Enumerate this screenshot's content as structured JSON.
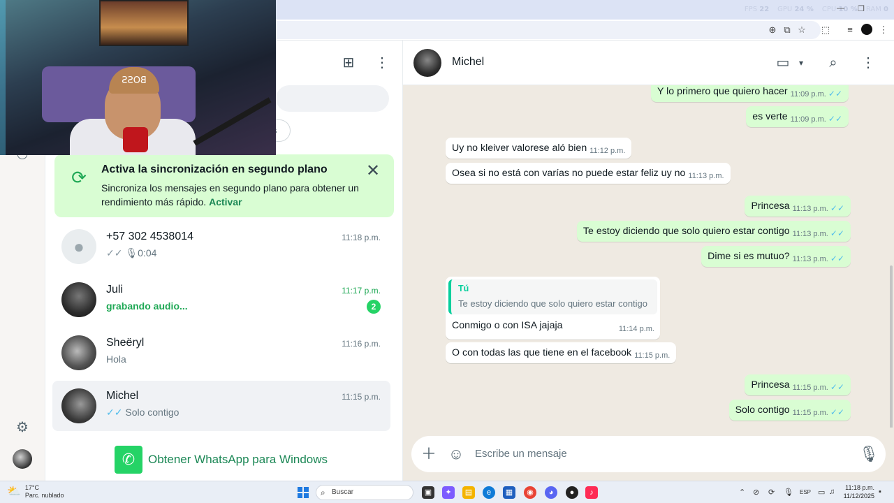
{
  "browser": {
    "stats": {
      "fps_label": "FPS",
      "fps": "22",
      "gpu_label": "GPU",
      "gpu": "24 %",
      "cpu_label": "CPU",
      "cpu": "10 %",
      "ram_label": "RAM",
      "ram": "0"
    }
  },
  "webcam": {
    "cap_text": "BOSS"
  },
  "chat_list": {
    "sync_banner": {
      "title": "Activa la sincronización en segundo plano",
      "body": "Sincroniza los mensajes en segundo plano para obtener un rendimiento más rápido.",
      "link": "Activar"
    },
    "filter_chip_fragment": "s",
    "chats": [
      {
        "name": "+57 302 4538014",
        "time": "11:18 p.m.",
        "ticks": "✓✓",
        "preview": "0:04",
        "preview_icon": "microphone-icon"
      },
      {
        "name": "Juli",
        "time": "11:17 p.m.",
        "preview": "grabando audio...",
        "unread": "2"
      },
      {
        "name": "Sheëryl",
        "time": "11:16 p.m.",
        "preview": "Hola"
      },
      {
        "name": "Michel",
        "time": "11:15 p.m.",
        "ticks": "✓✓",
        "preview": "Solo contigo"
      }
    ],
    "get_windows": "Obtener WhatsApp para Windows"
  },
  "conversation": {
    "contact_name": "Michel",
    "messages": [
      {
        "dir": "out",
        "text": "Y lo primero que quiero hacer",
        "time": "11:09 p.m.",
        "ticks": "✓✓"
      },
      {
        "dir": "out",
        "text": "es verte",
        "time": "11:09 p.m.",
        "ticks": "✓✓"
      },
      {
        "dir": "in",
        "text": "Uy no kleiver valorese aló bien",
        "time": "11:12 p.m."
      },
      {
        "dir": "in",
        "text": "Osea si no está con varías no puede estar feliz uy no",
        "time": "11:13 p.m."
      },
      {
        "dir": "out",
        "text": "Princesa",
        "time": "11:13 p.m.",
        "ticks": "✓✓"
      },
      {
        "dir": "out",
        "text": "Te estoy diciendo que solo quiero estar contigo",
        "time": "11:13 p.m.",
        "ticks": "✓✓"
      },
      {
        "dir": "out",
        "text": "Dime si es mutuo?",
        "time": "11:13 p.m.",
        "ticks": "✓✓"
      },
      {
        "dir": "in",
        "text": "O con todas las que tiene en el facebook",
        "time": "11:15 p.m."
      },
      {
        "dir": "out",
        "text": "Princesa",
        "time": "11:15 p.m.",
        "ticks": "✓✓"
      },
      {
        "dir": "out",
        "text": "Solo contigo",
        "time": "11:15 p.m.",
        "ticks": "✓✓"
      }
    ],
    "reply": {
      "quote_author": "Tú",
      "quote_text": "Te estoy diciendo que solo quiero estar contigo",
      "text": "Conmigo o con ISA  jajaja",
      "time": "11:14 p.m."
    },
    "composer_placeholder": "Escribe un mensaje"
  },
  "taskbar": {
    "weather_temp": "17°C",
    "weather_desc": "Parc. nublado",
    "search_text": "Buscar",
    "lang": "ESP",
    "time": "11:18 p.m.",
    "date": "11/12/2025"
  },
  "colors": {
    "accent": "#25d366",
    "banner_bg": "#d9fdd3",
    "outgoing_bubble": "#d9fdd3",
    "chat_bg": "#efeae2",
    "read_ticks": "#53bdeb"
  }
}
